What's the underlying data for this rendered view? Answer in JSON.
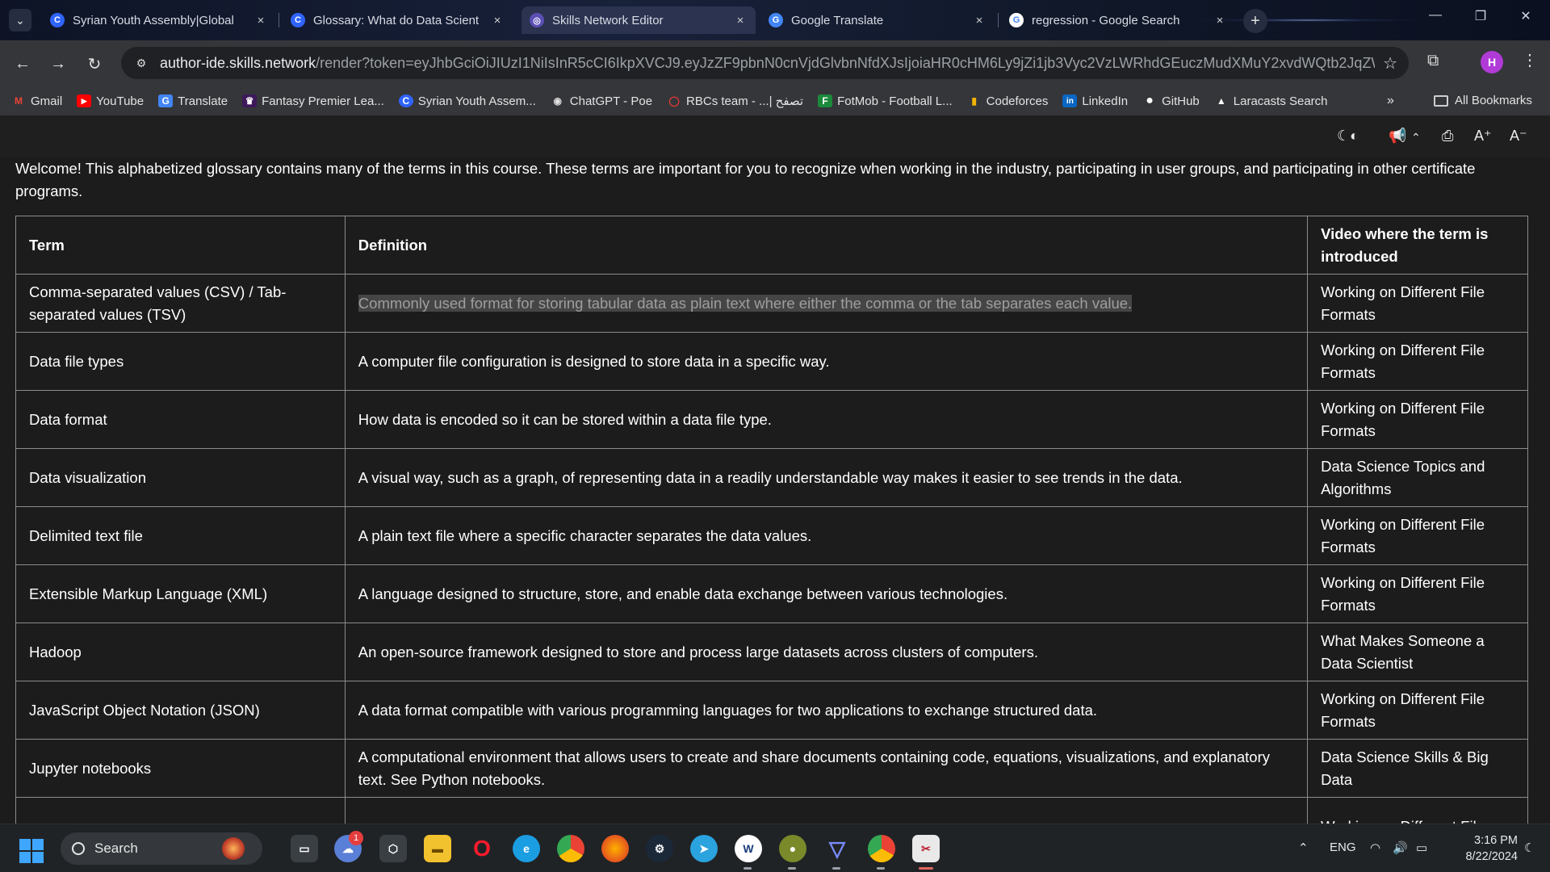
{
  "browser": {
    "tabs": [
      {
        "title": "Syrian Youth Assembly|Global",
        "favicon": "C",
        "favicon_bg": "#2f64ff",
        "active": false
      },
      {
        "title": "Glossary: What do Data Scient",
        "favicon": "C",
        "favicon_bg": "#2f64ff",
        "active": false
      },
      {
        "title": "Skills Network Editor",
        "favicon": "◎",
        "favicon_bg": "#5b4fb6",
        "active": true
      },
      {
        "title": "Google Translate",
        "favicon": "G",
        "favicon_bg": "#4285f4",
        "active": false
      },
      {
        "title": "regression - Google Search",
        "favicon": "G",
        "favicon_bg": "#ffffff",
        "active": false
      }
    ],
    "close_glyph": "×",
    "new_tab_glyph": "+",
    "tab_menu_glyph": "⌄",
    "window_controls": {
      "minimize": "—",
      "maximize": "❐",
      "close": "✕"
    },
    "nav": {
      "back": "←",
      "forward": "→",
      "reload": "↻"
    },
    "url_host": "author-ide.skills.network",
    "url_path": "/render?token=eyJhbGciOiJIUzI1NiIsInR5cCI6IkpXVCJ9.eyJzZF9pbnN0cnVjdGlvbnNfdXJsIjoiaHR0cHM6Ly9jZi1jb3Vyc2VzLWRhdGEuczMudXMuY2xvdWQtb2JqZWN0LXN...",
    "profile_initial": "H",
    "bookmarks": [
      {
        "label": "Gmail",
        "icon": "M",
        "color": "#ea4335"
      },
      {
        "label": "YouTube",
        "icon": "▶",
        "color": "#ff0000"
      },
      {
        "label": "Translate",
        "icon": "G",
        "color": "#4285f4"
      },
      {
        "label": "Fantasy Premier Lea...",
        "icon": "♛",
        "color": "#3d195b"
      },
      {
        "label": "Syrian Youth Assem...",
        "icon": "C",
        "color": "#2f64ff"
      },
      {
        "label": "ChatGPT - Poe",
        "icon": "◉",
        "color": "#555"
      },
      {
        "label": "RBCs team - ...| تصفح",
        "icon": "◯",
        "color": "#c62828"
      },
      {
        "label": "FotMob - Football L...",
        "icon": "F",
        "color": "#1b8a3b"
      },
      {
        "label": "Codeforces",
        "icon": "▮",
        "color": "#f2b400"
      },
      {
        "label": "LinkedIn",
        "icon": "in",
        "color": "#0a66c2"
      },
      {
        "label": "GitHub",
        "icon": "●",
        "color": "#333"
      },
      {
        "label": "Laracasts Search",
        "icon": "▲",
        "color": "#333"
      }
    ],
    "bookmarks_more": "»",
    "all_bookmarks": "All Bookmarks"
  },
  "page": {
    "intro": "Welcome! This alphabetized glossary contains many of the terms in this course. These terms are important for you to recognize when working in the industry, participating in user groups, and participating in other certificate programs.",
    "table": {
      "headers": [
        "Term",
        "Definition",
        "Video where the term is introduced"
      ],
      "rows": [
        {
          "term": "Comma-separated values (CSV) / Tab-separated values (TSV)",
          "definition": "Commonly used format for storing tabular data as plain text where either the comma or the tab separates each value.",
          "video": "Working on Different File Formats"
        },
        {
          "term": "Data file types",
          "definition": "A computer file configuration is designed to store data in a specific way.",
          "video": "Working on Different File Formats"
        },
        {
          "term": "Data format",
          "definition": "How data is encoded so it can be stored within a data file type.",
          "video": "Working on Different File Formats"
        },
        {
          "term": "Data visualization",
          "definition": "A visual way, such as a graph, of representing data in a readily understandable way makes it easier to see trends in the data.",
          "video": "Data Science Topics and Algorithms"
        },
        {
          "term": "Delimited text file",
          "definition": "A plain text file where a specific character separates the data values.",
          "video": "Working on Different File Formats"
        },
        {
          "term": "Extensible Markup Language (XML)",
          "definition": "A language designed to structure, store, and enable data exchange between various technologies.",
          "video": "Working on Different File Formats"
        },
        {
          "term": "Hadoop",
          "definition": "An open-source framework designed to store and process large datasets across clusters of computers.",
          "video": "What Makes Someone a Data Scientist"
        },
        {
          "term": "JavaScript Object Notation (JSON)",
          "definition": "A data format compatible with various programming languages for two applications to exchange structured data.",
          "video": "Working on Different File Formats"
        },
        {
          "term": "Jupyter notebooks",
          "definition": "A computational environment that allows users to create and share documents containing code, equations, visualizations, and explanatory text. See Python notebooks.",
          "video": "Data Science Skills & Big Data"
        },
        {
          "term": "",
          "definition": "",
          "video": "Working on Different File"
        }
      ]
    }
  },
  "taskbar": {
    "search_label": "Search",
    "notification_count": "1",
    "language": "ENG",
    "time": "3:16 PM",
    "date": "8/22/2024"
  }
}
